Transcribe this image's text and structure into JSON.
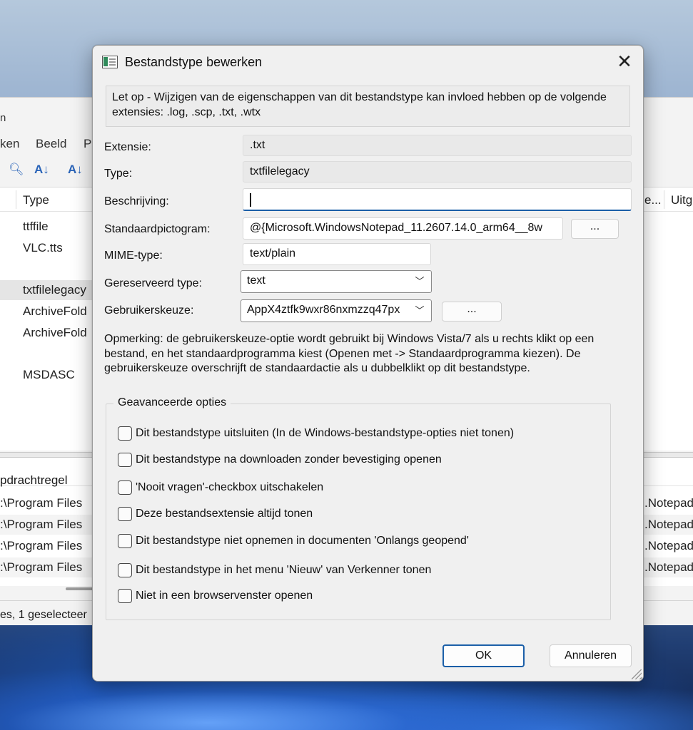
{
  "background_app": {
    "title_fragment": "n",
    "menu": [
      "ken",
      "Beeld",
      "P"
    ],
    "list_headers": [
      "Type",
      "e...",
      "Uitg"
    ],
    "list_rows": [
      "ttffile",
      "VLC.tts",
      "txtfilelegacy",
      "ArchiveFold",
      "ArchiveFold",
      "MSDASC"
    ],
    "selected_row": "txtfilelegacy",
    "lower_header": "pdrachtregel",
    "command_rows": [
      {
        "cmd": ":\\Program Files",
        "target": ".Notepad"
      },
      {
        "cmd": ":\\Program Files",
        "target": ".Notepad"
      },
      {
        "cmd": ":\\Program Files",
        "target": ".Notepad"
      },
      {
        "cmd": ":\\Program Files",
        "target": ".Notepad"
      }
    ],
    "status": "es, 1 geselecteer"
  },
  "dialog": {
    "title": "Bestandstype bewerken",
    "close_glyph": "✕",
    "notice": "Let op - Wijzigen van de eigenschappen van dit bestandstype kan invloed hebben op de volgende extensies: .log, .scp, .txt, .wtx",
    "fields": {
      "extension_label": "Extensie:",
      "extension_value": ".txt",
      "type_label": "Type:",
      "type_value": "txtfilelegacy",
      "description_label": "Beschrijving:",
      "description_value": "",
      "icon_label": "Standaardpictogram:",
      "icon_value": "@{Microsoft.WindowsNotepad_11.2607.14.0_arm64__8w",
      "icon_browse": "...",
      "mime_label": "MIME-type:",
      "mime_value": "text/plain",
      "perceived_label": "Gereserveerd type:",
      "perceived_value": "text",
      "userchoice_label": "Gebruikerskeuze:",
      "userchoice_value": "AppX4ztfk9wxr86nxmzzq47px",
      "userchoice_browse": "..."
    },
    "remark": "Opmerking: de gebruikerskeuze-optie wordt gebruikt bij Windows Vista/7 als u rechts klikt op een bestand, en het standaardprogramma kiest (Openen met -> Standaardprogramma kiezen). De gebruikerskeuze overschrijft de standaardactie als u dubbelklikt op dit bestandstype.",
    "advanced": {
      "legend": "Geavanceerde opties",
      "options": [
        {
          "label": "Dit bestandstype uitsluiten (In de Windows-bestandstype-opties niet tonen)",
          "checked": false
        },
        {
          "label": "Dit bestandstype na downloaden zonder bevestiging openen",
          "checked": false
        },
        {
          "label": "'Nooit vragen'-checkbox uitschakelen",
          "checked": false
        },
        {
          "label": "Deze bestandsextensie altijd tonen",
          "checked": false
        },
        {
          "label": "Dit bestandstype niet opnemen in documenten 'Onlangs geopend'",
          "checked": false
        },
        {
          "label": "Dit bestandstype in het menu 'Nieuw' van Verkenner tonen",
          "checked": false
        },
        {
          "label": "Niet in een browservenster openen",
          "checked": false
        }
      ]
    },
    "buttons": {
      "ok": "OK",
      "cancel": "Annuleren"
    },
    "colors": {
      "accent": "#1b5fa8",
      "dialog_bg": "#f0f0f0"
    }
  }
}
